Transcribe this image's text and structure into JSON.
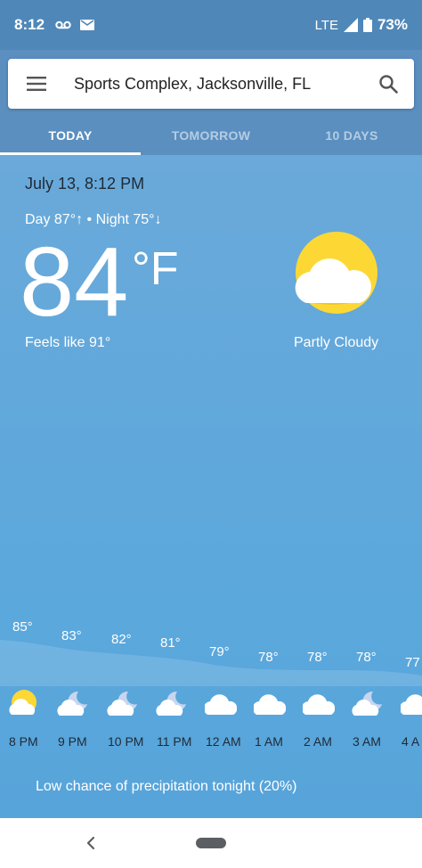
{
  "status": {
    "time": "8:12",
    "network": "LTE",
    "battery": "73%"
  },
  "search": {
    "location": "Sports Complex, Jacksonville, FL"
  },
  "tabs": [
    "TODAY",
    "TOMORROW",
    "10 DAYS"
  ],
  "current": {
    "date": "July 13, 8:12 PM",
    "day_night": "Day 87°↑ • Night 75°↓",
    "temp": "84",
    "unit": "°F",
    "feels_like": "Feels like 91°",
    "condition": "Partly Cloudy"
  },
  "hourly": [
    {
      "time": "8 PM",
      "temp": "85°",
      "icon": "partly-cloudy-icon"
    },
    {
      "time": "9 PM",
      "temp": "83°",
      "icon": "cloudy-moon-icon"
    },
    {
      "time": "10 PM",
      "temp": "82°",
      "icon": "cloudy-moon-icon"
    },
    {
      "time": "11 PM",
      "temp": "81°",
      "icon": "cloudy-moon-icon"
    },
    {
      "time": "12 AM",
      "temp": "79°",
      "icon": "cloud-icon"
    },
    {
      "time": "1 AM",
      "temp": "78°",
      "icon": "cloud-icon"
    },
    {
      "time": "2 AM",
      "temp": "78°",
      "icon": "cloud-icon"
    },
    {
      "time": "3 AM",
      "temp": "78°",
      "icon": "cloudy-moon-icon"
    },
    {
      "time": "4 A",
      "temp": "77",
      "icon": "cloud-icon"
    }
  ],
  "precipitation": "Low chance of precipitation tonight (20%)"
}
